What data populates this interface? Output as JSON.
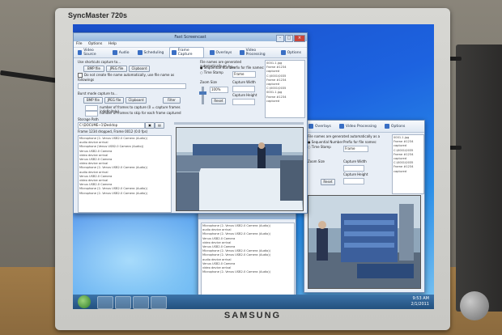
{
  "monitor": {
    "model": "SyncMaster 720s",
    "brand": "SAMSUNG"
  },
  "app": {
    "title": "Fast Screencast",
    "menu": [
      "File",
      "Options",
      "Help"
    ],
    "tabs": [
      {
        "label": "Video Source",
        "icon": "camera-icon"
      },
      {
        "label": "Audio",
        "icon": "microphone-icon"
      },
      {
        "label": "Scheduling",
        "icon": "calendar-icon"
      },
      {
        "label": "Frame Capture",
        "icon": "frame-icon",
        "active": true
      },
      {
        "label": "Overlays",
        "icon": "layers-icon"
      },
      {
        "label": "Video Processing",
        "icon": "tools-icon"
      },
      {
        "label": "Options",
        "icon": "gear-icon"
      }
    ],
    "capture_heading": "Use shortcuts capture to...",
    "capture_buttons": [
      "BMP file",
      "JPEG file",
      "Clipboard"
    ],
    "checkbox_note": "Do not create file name automatically, use file name as followings",
    "burst_heading": "Burst mode capture to...",
    "burst_buttons": [
      "BMP file",
      "JPEG file",
      "Clipboard",
      "Filter"
    ],
    "burst_lines": [
      "number of frames to capture  (0 = capture frames indefinitely)",
      "number of frames to skip for each frame captured"
    ],
    "file_name_note": "File names are generated automatically as a",
    "radio_options": [
      "Sequential Number",
      "Time Stamp"
    ],
    "prefix_label": "Prefix for file names:",
    "prefix_value": "Frame",
    "zoom_label": "Zoom Size",
    "zoom_value": "100%",
    "capture_width_label": "Capture Width",
    "capture_height_label": "Capture Height",
    "reset_label": "Reset",
    "storage_label": "Storage Path",
    "storage_path": "C:\\DOCUME~1\\Desktop",
    "storage_info": "Frame 1234 dropped, Frame 0012 (0.0 fps)",
    "log_lines": [
      "Microphone (2- Venus USB2.0 Camera (Audio))",
      "audio device arrival",
      "Microphone (Venus USB2.0 Camera (Audio))",
      "Venus USB2.0 Camera",
      "video device arrival",
      "Venus USB2.0 Camera",
      "video device arrival",
      "Microphone (2- Venus USB2.0 Camera (Audio))",
      "audio device arrival",
      "Venus USB2.0 Camera",
      "video device arrival",
      "Venus USB2.0 Camera",
      "Microphone (2- Venus USB2.0 Camera (Audio))",
      "Microphone (2- Venus USB2.0 Camera (Audio))"
    ],
    "right_log": [
      "0001.1.jpg",
      "Frame #1234",
      "captured",
      "C:\\0001\\0035",
      "Frame #1234",
      "captured",
      "C:\\0001\\0035",
      "0001.1.jpg",
      "Frame #1234",
      "captured"
    ]
  },
  "second_window": {
    "tabs": [
      "Overlays",
      "Video Processing",
      "Options"
    ],
    "file_name_note": "File names are generated automatically as a",
    "radio_options": [
      "Sequential Number",
      "Time Stamp"
    ],
    "prefix_label": "Prefix for file names:",
    "prefix_value": "Frame",
    "zoom_label": "Zoom Size",
    "capture_width_label": "Capture Width",
    "capture_height_label": "Capture Height",
    "reset_label": "Reset",
    "log_lines": [
      "0001.1.jpg",
      "Frame #1234",
      "captured",
      "C:\\0001\\0035",
      "Frame #1234",
      "captured",
      "C:\\0001\\0035",
      "Frame #1234",
      "captured"
    ]
  },
  "third_window": {
    "log_lines": [
      "Microphone (2- Venus USB2.0 Camera (Audio))",
      "audio device arrival",
      "Microphone (2- Venus USB2.0 Camera (Audio))",
      "Venus USB2.0 Camera",
      "video device arrival",
      "Venus USB2.0 Camera",
      "Microphone (2- Venus USB2.0 Camera (Audio))",
      "Microphone (2- Venus USB2.0 Camera (Audio))",
      "audio device arrival",
      "Venus USB2.0 Camera",
      "video device arrival",
      "Microphone (2- Venus USB2.0 Camera (Audio))"
    ]
  },
  "taskbar": {
    "time": "9:53 AM",
    "date": "2/1/2011"
  },
  "colors": {
    "desktop": "#1d63e0",
    "taskbar": "#2b5a8a",
    "titlebar": "#a9c4e4"
  }
}
